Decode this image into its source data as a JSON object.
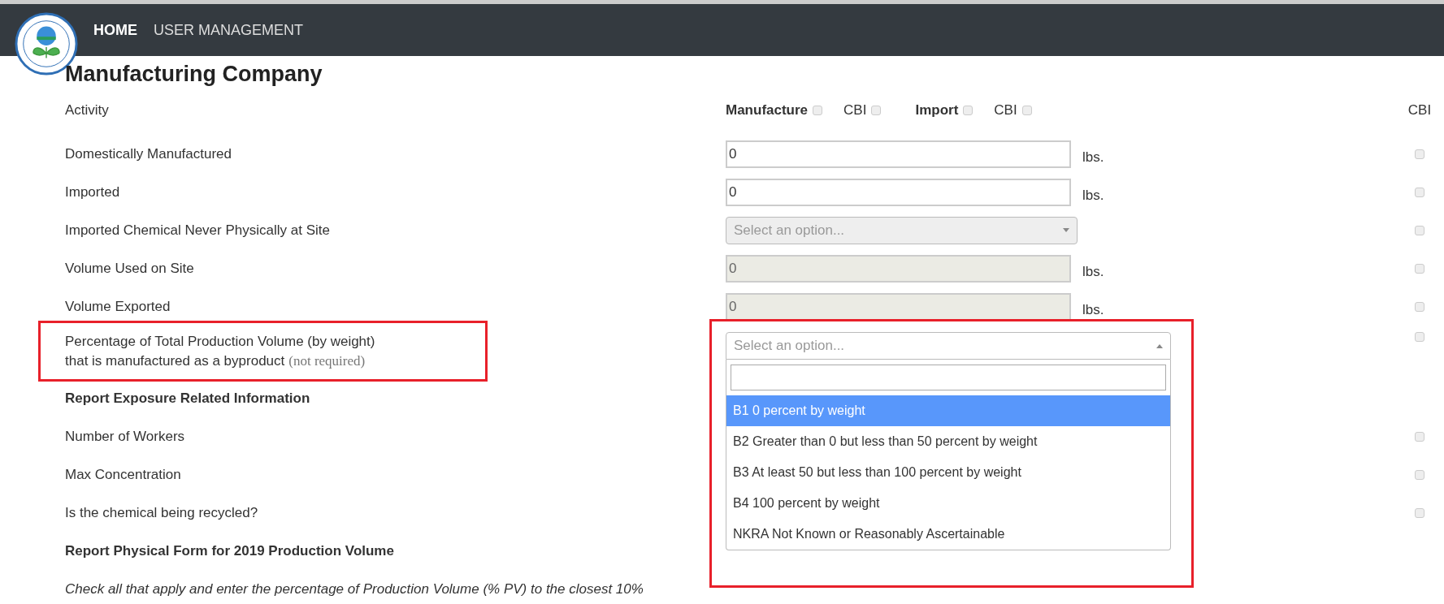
{
  "nav": {
    "items": [
      {
        "label": "HOME",
        "selected": true
      },
      {
        "label": "USER MANAGEMENT",
        "selected": false
      }
    ]
  },
  "title": "Manufacturing Company",
  "activity": {
    "label": "Activity",
    "options": [
      {
        "kind": "main",
        "label": "Manufacture",
        "checked": false
      },
      {
        "kind": "cbi",
        "label": "CBI",
        "checked": false
      },
      {
        "kind": "main",
        "label": "Import",
        "checked": false
      },
      {
        "kind": "cbi",
        "label": "CBI",
        "checked": false
      }
    ],
    "cbi_header": "CBI"
  },
  "rows": [
    {
      "kind": "input",
      "label": "Domestically Manufactured",
      "value": "0",
      "unit": "lbs.",
      "disabled": false,
      "cbi_checked": false
    },
    {
      "kind": "input",
      "label": "Imported",
      "value": "0",
      "unit": "lbs.",
      "disabled": false,
      "cbi_checked": false
    },
    {
      "kind": "select",
      "label": "Imported Chemical Never Physically at Site",
      "placeholder": "Select an option...",
      "disabled": true,
      "open": false,
      "cbi_checked": false
    },
    {
      "kind": "input",
      "label": "Volume Used on Site",
      "value": "0",
      "unit": "lbs.",
      "disabled": true,
      "cbi_checked": false
    },
    {
      "kind": "input",
      "label": "Volume Exported",
      "value": "0",
      "unit": "lbs.",
      "disabled": true,
      "cbi_checked": false
    },
    {
      "kind": "select",
      "label_lines": [
        "Percentage of Total Production Volume (by weight)",
        "that is manufactured as a byproduct"
      ],
      "hint": "(not required)",
      "highlighted": true,
      "placeholder": "Select an option...",
      "disabled": false,
      "open": true,
      "cbi_checked": false,
      "options": [
        {
          "label": "B1 0 percent by weight",
          "selected": true
        },
        {
          "label": "B2 Greater than 0 but less than 50 percent by weight",
          "selected": false
        },
        {
          "label": "B3 At least 50 but less than 100 percent by weight",
          "selected": false
        },
        {
          "label": "B4 100 percent by weight",
          "selected": false
        },
        {
          "label": "NKRA Not Known or Reasonably Ascertainable",
          "selected": false
        }
      ]
    },
    {
      "kind": "heading",
      "label": "Report Exposure Related Information"
    },
    {
      "kind": "plain",
      "label": "Number of Workers",
      "cbi_checked": false
    },
    {
      "kind": "plain",
      "label": "Max Concentration",
      "cbi_checked": false
    },
    {
      "kind": "plain",
      "label": "Is the chemical being recycled?",
      "cbi_checked": false
    },
    {
      "kind": "heading",
      "label": "Report Physical Form for 2019 Production Volume"
    },
    {
      "kind": "note",
      "label": "Check all that apply and enter the percentage of Production Volume (% PV) to the closest 10%"
    }
  ]
}
